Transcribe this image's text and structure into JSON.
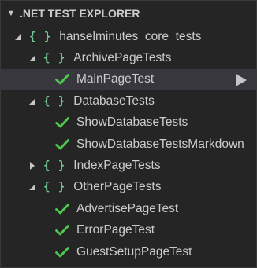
{
  "header": {
    "title": ".NET TEST EXPLORER"
  },
  "colors": {
    "background": "#252526",
    "selected_row": "#37373d",
    "namespace_brace": "#73c991",
    "pass_check": "#4ec94e",
    "text": "#cccccc"
  },
  "tree": {
    "root": {
      "label": "hanselminutes_core_tests",
      "icon": "namespace-brace-icon",
      "expanded": true
    },
    "archive": {
      "label": "ArchivePageTests",
      "expanded": true,
      "tests": [
        {
          "label": "MainPageTest",
          "status": "passed",
          "selected": true
        }
      ]
    },
    "database": {
      "label": "DatabaseTests",
      "expanded": true,
      "tests": [
        {
          "label": "ShowDatabaseTests",
          "status": "passed"
        },
        {
          "label": "ShowDatabaseTestsMarkdown",
          "status": "passed"
        }
      ]
    },
    "index": {
      "label": "IndexPageTests",
      "expanded": false
    },
    "other": {
      "label": "OtherPageTests",
      "expanded": true,
      "tests": [
        {
          "label": "AdvertisePageTest",
          "status": "passed"
        },
        {
          "label": "ErrorPageTest",
          "status": "passed"
        },
        {
          "label": "GuestSetupPageTest",
          "status": "passed"
        }
      ]
    },
    "brace_glyph": "{ }"
  }
}
